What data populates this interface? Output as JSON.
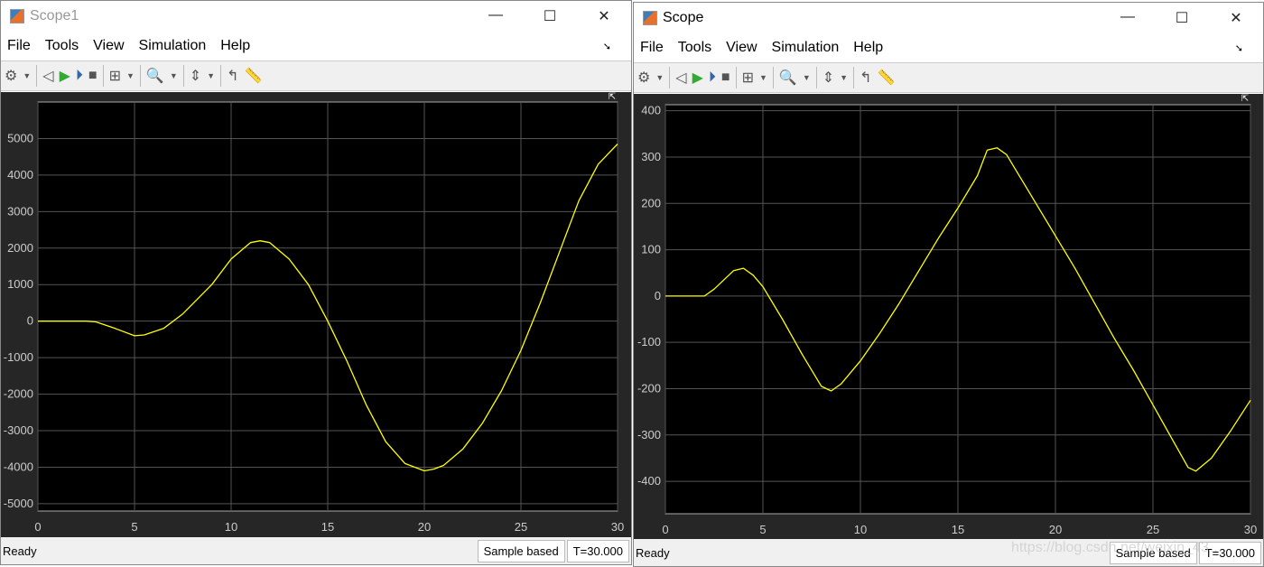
{
  "windows": [
    {
      "title": "Scope1",
      "menu": [
        "File",
        "Tools",
        "View",
        "Simulation",
        "Help"
      ],
      "status": "Ready",
      "sample_mode": "Sample based",
      "time": "T=30.000"
    },
    {
      "title": "Scope",
      "menu": [
        "File",
        "Tools",
        "View",
        "Simulation",
        "Help"
      ],
      "status": "Ready",
      "sample_mode": "Sample based",
      "time": "T=30.000"
    }
  ],
  "window_controls": {
    "minimize": "—",
    "maximize": "☐",
    "close": "✕"
  },
  "toolbar_icons": [
    "gear-icon",
    "restore-icon",
    "run-icon",
    "step-forward-icon",
    "stop-icon",
    "signal-selector-icon",
    "zoom-in-icon",
    "autoscale-icon",
    "triggers-icon",
    "cursor-measurements-icon"
  ],
  "watermark": "https://blog.csdn.net/weixin_43…",
  "chart_data": [
    {
      "type": "line",
      "xlim": [
        0,
        30
      ],
      "ylim": [
        -5200,
        6000
      ],
      "grid": true,
      "line_color": "#ffff00",
      "xticks": [
        0,
        5,
        10,
        15,
        20,
        25,
        30
      ],
      "yticks": [
        -5000,
        -4000,
        -3000,
        -2000,
        -1000,
        0,
        1000,
        2000,
        3000,
        4000,
        5000
      ],
      "x": [
        0,
        2.5,
        3,
        4,
        5,
        5.5,
        6.5,
        7.5,
        9,
        10,
        11,
        11.5,
        12,
        13,
        14,
        15,
        16,
        17,
        18,
        19,
        20,
        20.5,
        21,
        22,
        23,
        24,
        25,
        26,
        27,
        28,
        29,
        30
      ],
      "y": [
        0,
        0,
        -20,
        -200,
        -400,
        -380,
        -200,
        200,
        1000,
        1700,
        2150,
        2200,
        2150,
        1700,
        1000,
        0,
        -1100,
        -2300,
        -3300,
        -3900,
        -4100,
        -4050,
        -3950,
        -3500,
        -2800,
        -1900,
        -800,
        500,
        1900,
        3300,
        4300,
        4850
      ]
    },
    {
      "type": "line",
      "xlim": [
        0,
        30
      ],
      "ylim": [
        -470,
        413
      ],
      "grid": true,
      "line_color": "#ffff00",
      "xticks": [
        0,
        5,
        10,
        15,
        20,
        25,
        30
      ],
      "yticks": [
        -400,
        -300,
        -200,
        -100,
        0,
        100,
        200,
        300,
        400
      ],
      "x": [
        0,
        2,
        2.5,
        3.5,
        4,
        4.5,
        5,
        6,
        7,
        8,
        8.5,
        9,
        10,
        11,
        12,
        13,
        14,
        15,
        16,
        16.5,
        17,
        17.5,
        18,
        19,
        20,
        21,
        22,
        23,
        24,
        25,
        26,
        26.8,
        27.2,
        28,
        29,
        30
      ],
      "y": [
        0,
        0,
        15,
        55,
        60,
        45,
        20,
        -50,
        -125,
        -195,
        -205,
        -190,
        -140,
        -80,
        -15,
        55,
        125,
        190,
        260,
        315,
        320,
        305,
        270,
        200,
        130,
        60,
        -15,
        -90,
        -160,
        -235,
        -310,
        -370,
        -378,
        -350,
        -290,
        -225
      ]
    }
  ]
}
